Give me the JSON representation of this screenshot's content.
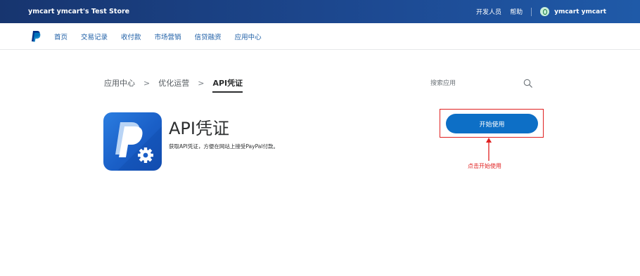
{
  "header": {
    "store_name": "ymcart ymcart's Test Store",
    "links": [
      "开发人员",
      "帮助"
    ],
    "user_name": "ymcart ymcart"
  },
  "nav": {
    "items": [
      "首页",
      "交易记录",
      "收付款",
      "市场营销",
      "信贷融资",
      "应用中心"
    ]
  },
  "breadcrumb": {
    "items": [
      "应用中心",
      "优化运营"
    ],
    "current": "API凭证",
    "separator": ">"
  },
  "search": {
    "placeholder": "搜索应用"
  },
  "app": {
    "title": "API凭证",
    "description": "获取API凭证，方便在网站上接受PayPal付款。"
  },
  "actions": {
    "start_label": "开始使用"
  },
  "annotation": {
    "text": "点击开始使用"
  },
  "colors": {
    "header_bg": "#1d4a93",
    "nav_link": "#1d5ea6",
    "primary_button": "#0d6fc6",
    "annotation_red": "#e02020"
  },
  "icons": [
    "paypal-logo-icon",
    "avatar-icon",
    "search-icon",
    "paypal-gear-app-icon"
  ]
}
